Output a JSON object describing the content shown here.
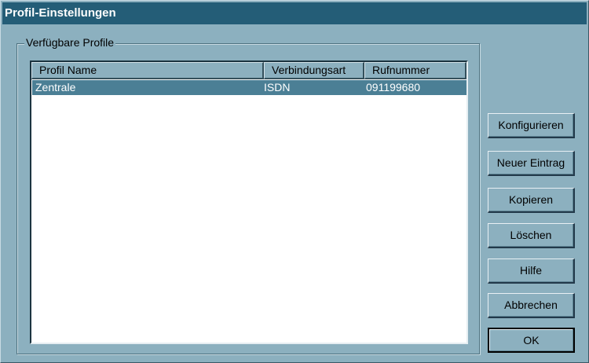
{
  "window": {
    "title": "Profil-Einstellungen"
  },
  "group": {
    "label": "Verfügbare Profile"
  },
  "table": {
    "columns": [
      "Profil Name",
      "Verbindungsart",
      "Rufnummer"
    ],
    "rows": [
      {
        "name": "Zentrale",
        "type": "ISDN",
        "number": "091199680",
        "selected": true
      }
    ]
  },
  "buttons": {
    "configure": "Konfigurieren",
    "new_entry": "Neuer Eintrag",
    "copy": "Kopieren",
    "delete": "Löschen",
    "help": "Hilfe",
    "cancel": "Abbrechen",
    "ok": "OK"
  },
  "colors": {
    "titlebar": "#245d77",
    "dialog_bg": "#8cb0bf",
    "selection": "#4b7f95"
  }
}
